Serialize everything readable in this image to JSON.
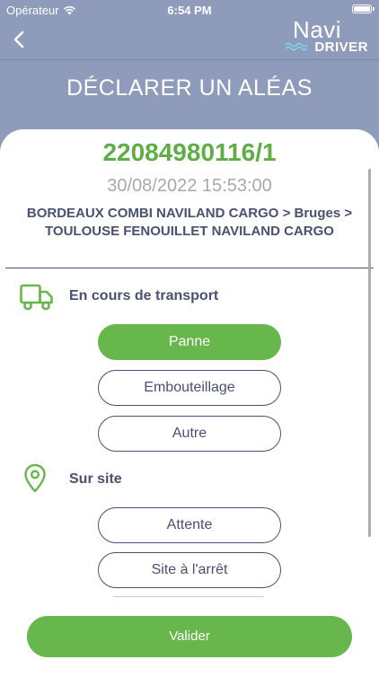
{
  "status_bar": {
    "carrier": "Opérateur",
    "time": "6:54 PM"
  },
  "header": {
    "logo_top": "Navi",
    "logo_bottom": "DRIVER",
    "title": "DÉCLARER UN ALÉAS"
  },
  "order": {
    "number": "22084980116/1",
    "datetime": "30/08/2022 15:53:00",
    "route_line1": "BORDEAUX COMBI NAVILAND CARGO > Bruges >",
    "route_line2": "TOULOUSE FENOUILLET NAVILAND CARGO"
  },
  "sections": {
    "transport": {
      "label": "En cours de transport",
      "options": [
        "Panne",
        "Embouteillage",
        "Autre"
      ],
      "selected": "Panne"
    },
    "site": {
      "label": "Sur site",
      "options": [
        "Attente",
        "Site à l'arrêt"
      ]
    }
  },
  "actions": {
    "validate_label": "Valider"
  },
  "colors": {
    "header_bg": "#8e9bbb",
    "accent_green": "#67b74c",
    "text_dark": "#4a5170",
    "text_muted": "#a9a9a9"
  },
  "icons": {
    "back": "chevron-left-icon",
    "transport": "truck-icon",
    "site": "map-pin-icon",
    "wifi": "wifi-icon",
    "battery": "battery-icon"
  }
}
